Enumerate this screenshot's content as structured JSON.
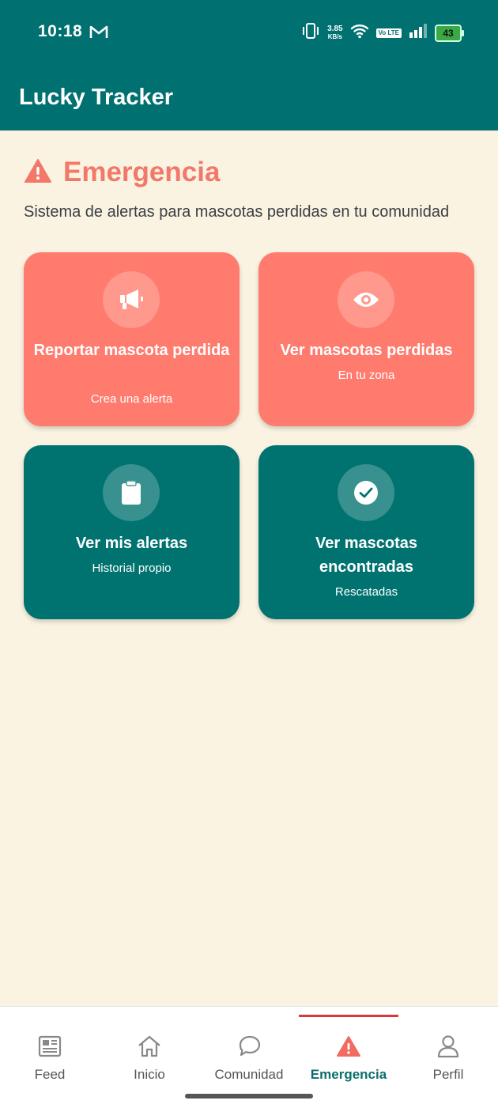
{
  "status_bar": {
    "time": "10:18",
    "net_speed": "3.85",
    "net_unit": "KB/s",
    "volte": "Vo LTE",
    "battery": "43",
    "icons": [
      "gmail-icon",
      "vibrate-icon",
      "wifi-icon",
      "signal-icon",
      "battery-charging-icon"
    ]
  },
  "app_bar": {
    "title": "Lucky Tracker"
  },
  "page": {
    "icon": "warning-icon",
    "title": "Emergencia",
    "subtitle": "Sistema de alertas para mascotas perdidas en tu comunidad"
  },
  "cards": [
    {
      "title": "Reportar mascota perdida",
      "subtitle": "Crea una alerta",
      "icon": "megaphone-icon"
    },
    {
      "title": "Ver mascotas perdidas",
      "subtitle": "En tu zona",
      "icon": "eye-icon"
    },
    {
      "title": "Ver mis alertas",
      "subtitle": "Historial propio",
      "icon": "clipboard-icon"
    },
    {
      "title": "Ver mascotas encontradas",
      "subtitle": "Rescatadas",
      "icon": "check-circle-icon"
    }
  ],
  "bottom_nav": {
    "active": "Emergencia",
    "items": [
      {
        "label": "Feed",
        "icon": "newspaper-icon"
      },
      {
        "label": "Inicio",
        "icon": "home-icon"
      },
      {
        "label": "Comunidad",
        "icon": "chat-bubble-icon"
      },
      {
        "label": "Emergencia",
        "icon": "warning-icon"
      },
      {
        "label": "Perfil",
        "icon": "person-icon"
      }
    ]
  },
  "colors": {
    "primary": "#007070",
    "alert": "#FF7B6E",
    "background": "#FAF3E1",
    "nav_indicator": "#D9363E"
  }
}
